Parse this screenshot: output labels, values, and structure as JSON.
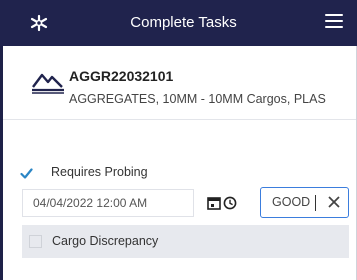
{
  "app": {
    "title": "Complete Tasks",
    "logo_icon": "asterisk-logo-icon",
    "menu_icon": "hamburger-menu-icon"
  },
  "cargo": {
    "code": "AGGR22032101",
    "description": "AGGREGATES, 10MM - 10MM Cargos, PLAS",
    "icon": "mountain-cargo-icon"
  },
  "form": {
    "requires_probing": {
      "label": "Requires Probing",
      "checked": true
    },
    "datetime_value": "04/04/2022 12:00 AM",
    "calendar_icon": "calendar-icon",
    "clock_icon": "clock-icon",
    "result_value": "GOOD",
    "clear_icon": "close-icon",
    "cargo_discrepancy": {
      "label": "Cargo Discrepancy",
      "checked": false
    }
  },
  "colors": {
    "header_bg": "#20234d",
    "accent": "#3b7ddd",
    "checkbox": "#2b86c5"
  }
}
